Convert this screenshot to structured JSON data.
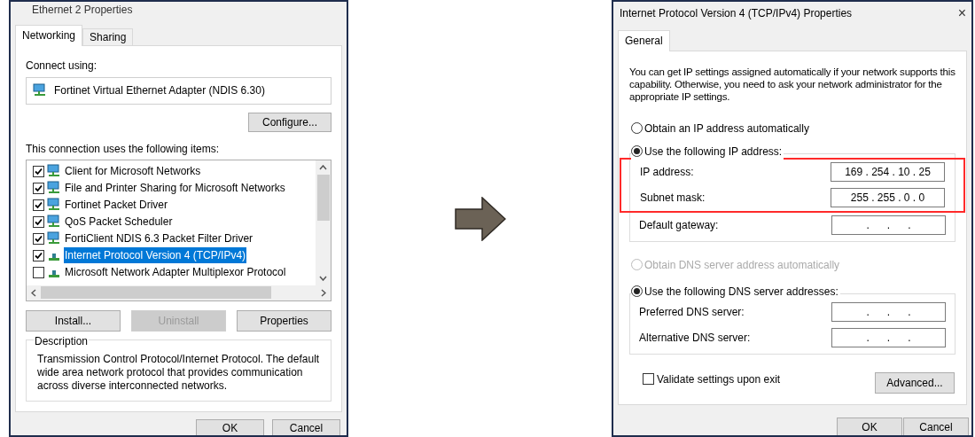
{
  "left_dialog": {
    "title": "Ethernet 2 Properties",
    "tabs": [
      {
        "label": "Networking",
        "selected": true
      },
      {
        "label": "Sharing",
        "selected": false
      }
    ],
    "connect_using_label": "Connect using:",
    "adapter": "Fortinet Virtual Ethernet Adapter (NDIS 6.30)",
    "configure_button": "Configure...",
    "items_label": "This connection uses the following items:",
    "items": [
      {
        "label": "Client for Microsoft Networks",
        "checked": true,
        "selected": false,
        "kind": "service"
      },
      {
        "label": "File and Printer Sharing for Microsoft Networks",
        "checked": true,
        "selected": false,
        "kind": "service"
      },
      {
        "label": "Fortinet Packet Driver",
        "checked": true,
        "selected": false,
        "kind": "service"
      },
      {
        "label": "QoS Packet Scheduler",
        "checked": true,
        "selected": false,
        "kind": "service"
      },
      {
        "label": "FortiClient NDIS 6.3 Packet Filter Driver",
        "checked": true,
        "selected": false,
        "kind": "service"
      },
      {
        "label": "Internet Protocol Version 4 (TCP/IPv4)",
        "checked": true,
        "selected": true,
        "kind": "protocol"
      },
      {
        "label": "Microsoft Network Adapter Multiplexor Protocol",
        "checked": false,
        "selected": false,
        "kind": "protocol"
      }
    ],
    "buttons": [
      {
        "label": "Install...",
        "disabled": false
      },
      {
        "label": "Uninstall",
        "disabled": true
      },
      {
        "label": "Properties",
        "disabled": false
      }
    ],
    "description_title": "Description",
    "description": "Transmission Control Protocol/Internet Protocol. The default wide area network protocol that provides communication across diverse interconnected networks.",
    "footer_buttons": [
      "OK",
      "Cancel"
    ]
  },
  "right_dialog": {
    "title": "Internet Protocol Version 4 (TCP/IPv4) Properties",
    "close": "×",
    "tabs": [
      {
        "label": "General",
        "selected": true
      }
    ],
    "intro": "You can get IP settings assigned automatically if your network supports this capability. Otherwise, you need to ask your network administrator for the appropriate IP settings.",
    "ip_radios": [
      {
        "label": "Obtain an IP address automatically",
        "selected": false,
        "disabled": false
      },
      {
        "label": "Use the following IP address:",
        "selected": true,
        "disabled": false
      }
    ],
    "ip_fields": [
      {
        "label": "IP address:",
        "value": "169 . 254 . 10 . 25",
        "highlighted": true
      },
      {
        "label": "Subnet mask:",
        "value": "255 . 255 . 0 . 0",
        "highlighted": true
      },
      {
        "label": "Default gateway:",
        "value": ".      .      .",
        "highlighted": false
      }
    ],
    "dns_radios": [
      {
        "label": "Obtain DNS server address automatically",
        "selected": false,
        "disabled": true
      },
      {
        "label": "Use the following DNS server addresses:",
        "selected": true,
        "disabled": false
      }
    ],
    "dns_fields": [
      {
        "label": "Preferred DNS server:",
        "value": ".      .      ."
      },
      {
        "label": "Alternative DNS server:",
        "value": ".      .      ."
      }
    ],
    "validate": {
      "label": "Validate settings upon exit",
      "checked": false
    },
    "advanced_button": "Advanced...",
    "footer_buttons": [
      "OK",
      "Cancel"
    ]
  }
}
